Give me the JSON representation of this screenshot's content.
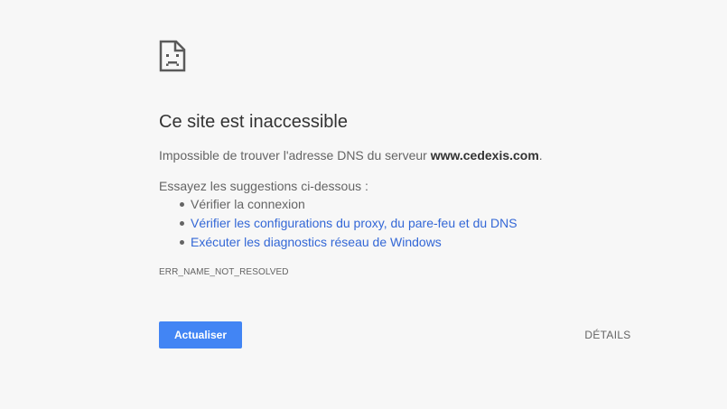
{
  "icon": "sad-page-icon",
  "title": "Ce site est inaccessible",
  "description": {
    "prefix": "Impossible de trouver l'adresse DNS du serveur ",
    "host": "www.cedexis.com",
    "suffix": "."
  },
  "suggestions_title": "Essayez les suggestions ci-dessous :",
  "suggestions": [
    {
      "label": "Vérifier la connexion"
    },
    {
      "label": "Vérifier les configurations du proxy, du pare-feu et du DNS"
    },
    {
      "label": "Exécuter les diagnostics réseau de Windows"
    }
  ],
  "error_code": "ERR_NAME_NOT_RESOLVED",
  "buttons": {
    "reload": "Actualiser",
    "details": "DÉTAILS"
  },
  "colors": {
    "background": "#f7f7f7",
    "primary_button": "#4285f4",
    "link": "#3367d6"
  }
}
